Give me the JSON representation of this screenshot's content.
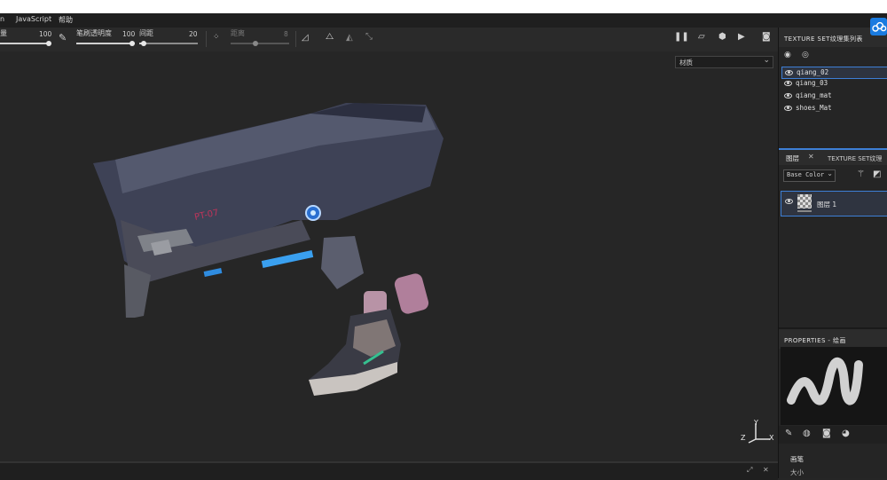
{
  "menu": {
    "items": [
      "n",
      "JavaScript",
      "帮助"
    ]
  },
  "toolbar": {
    "size_label": "量",
    "size_value": "100",
    "opacity_label": "笔刷透明度",
    "opacity_value": "100",
    "spacing_label": "间距",
    "spacing_value": "20",
    "distance_label": "距离",
    "distance_value": "8"
  },
  "viewport": {
    "material_select": "材质",
    "axis": {
      "x": "X",
      "y": "Y",
      "z": "Z"
    }
  },
  "texture_sets": {
    "title": "TEXTURE SET纹理集列表",
    "items": [
      {
        "name": "qiang_02",
        "selected": true
      },
      {
        "name": "qiang_03",
        "selected": false
      },
      {
        "name": "qiang_mat",
        "selected": false
      },
      {
        "name": "shoes_Mat",
        "selected": false
      }
    ]
  },
  "layers": {
    "tab_active": "图层",
    "tab_other": "TEXTURE SET纹理",
    "channel": "Base Color",
    "items": [
      {
        "name": "图层 1"
      }
    ]
  },
  "properties": {
    "title": "PROPERTIES - 绘画",
    "section": "画笔",
    "size_label": "大小"
  },
  "colors": {
    "accent": "#3d7fd6",
    "panel": "#252525",
    "viewport": "#262626"
  }
}
